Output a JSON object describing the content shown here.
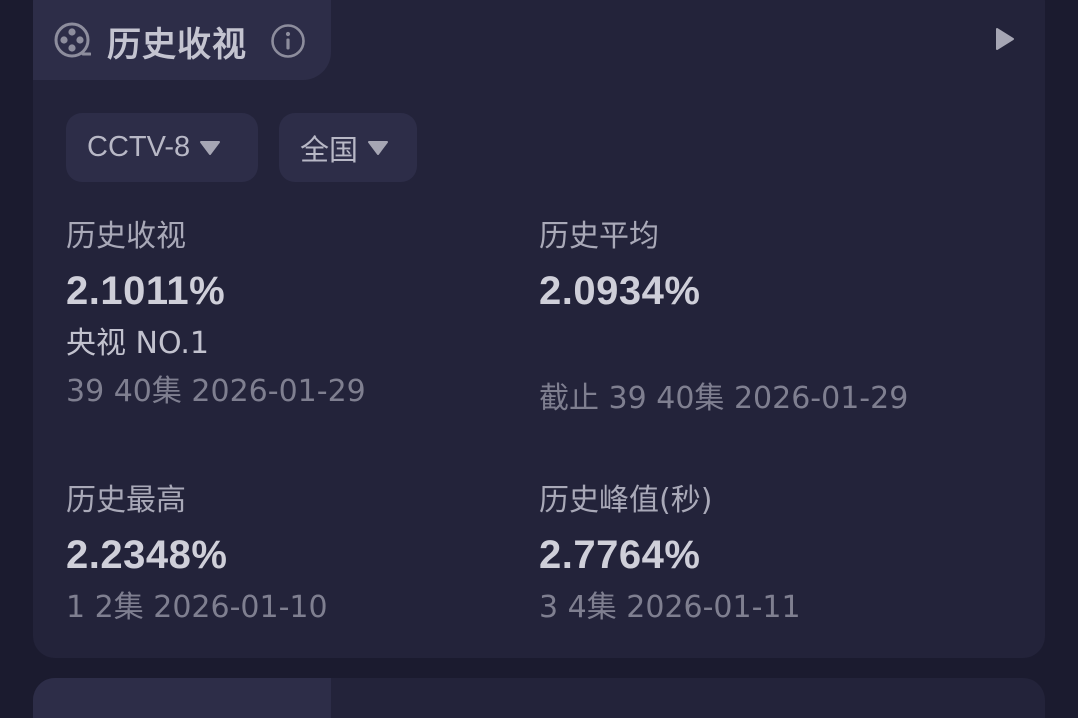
{
  "card": {
    "title": "历史收视",
    "title_icon": "film-reel-icon",
    "info_icon": "info-icon",
    "more_icon": "play-arrow-icon"
  },
  "filters": {
    "channel": "CCTV-8",
    "region": "全国"
  },
  "stats": {
    "history_rating": {
      "label": "历史收视",
      "value": "2.1011%",
      "rank": "央视 NO.1",
      "sub": "39 40集 2026-01-29"
    },
    "history_average": {
      "label": "历史平均",
      "value": "2.0934%",
      "sub": "截止 39 40集 2026-01-29"
    },
    "history_highest": {
      "label": "历史最高",
      "value": "2.2348%",
      "sub": "1 2集 2026-01-10"
    },
    "history_peak": {
      "label": "历史峰值(秒)",
      "value": "2.7764%",
      "sub": "3 4集 2026-01-11"
    }
  },
  "colors": {
    "background": "#1b1b2f",
    "card": "#23233a",
    "tab": "#2d2d48",
    "text_primary": "#cfcfd9",
    "text_secondary": "#7f7f90"
  }
}
